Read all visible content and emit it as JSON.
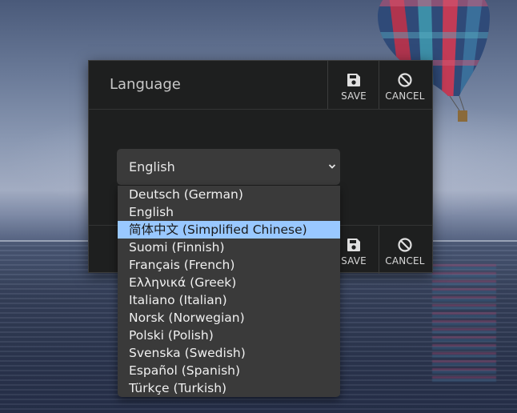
{
  "dialog": {
    "title": "Language",
    "save_label": "SAVE",
    "cancel_label": "CANCEL",
    "save_icon": "save-icon",
    "cancel_icon": "cancel-icon"
  },
  "language_select": {
    "value": "English",
    "options": [
      "Deutsch (German)",
      "English",
      "简体中文 (Simplified Chinese)",
      "Suomi (Finnish)",
      "Français (French)",
      "Ελληνικά (Greek)",
      "Italiano (Italian)",
      "Norsk (Norwegian)",
      "Polski (Polish)",
      "Svenska (Swedish)",
      "Español (Spanish)",
      "Türkçe (Turkish)"
    ],
    "highlighted_index": 2,
    "highlight_color": "#99c8ff"
  },
  "colors": {
    "dialog_bg": "#1e1f1f",
    "select_bg": "#3a3a3a",
    "text": "#e6e6e6"
  }
}
